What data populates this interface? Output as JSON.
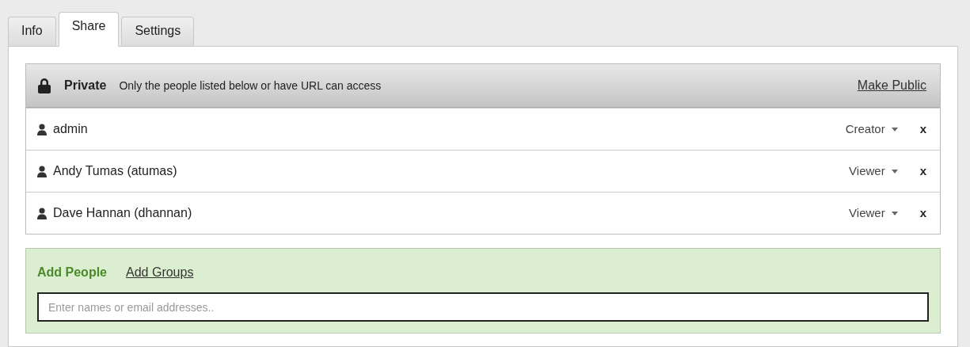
{
  "tabs": [
    {
      "label": "Info",
      "selected": false
    },
    {
      "label": "Share",
      "selected": true
    },
    {
      "label": "Settings",
      "selected": false
    }
  ],
  "access": {
    "title": "Private",
    "description": "Only the people listed below or have URL can access",
    "action": "Make Public"
  },
  "people": [
    {
      "name": "admin",
      "role": "Creator",
      "remove": "x"
    },
    {
      "name": "Andy Tumas (atumas)",
      "role": "Viewer",
      "remove": "x"
    },
    {
      "name": "Dave Hannan (dhannan)",
      "role": "Viewer",
      "remove": "x"
    }
  ],
  "add_modes": [
    {
      "label": "Add People",
      "selected": true
    },
    {
      "label": "Add Groups",
      "selected": false
    }
  ],
  "add_field": {
    "placeholder": "Enter names or email addresses.."
  }
}
